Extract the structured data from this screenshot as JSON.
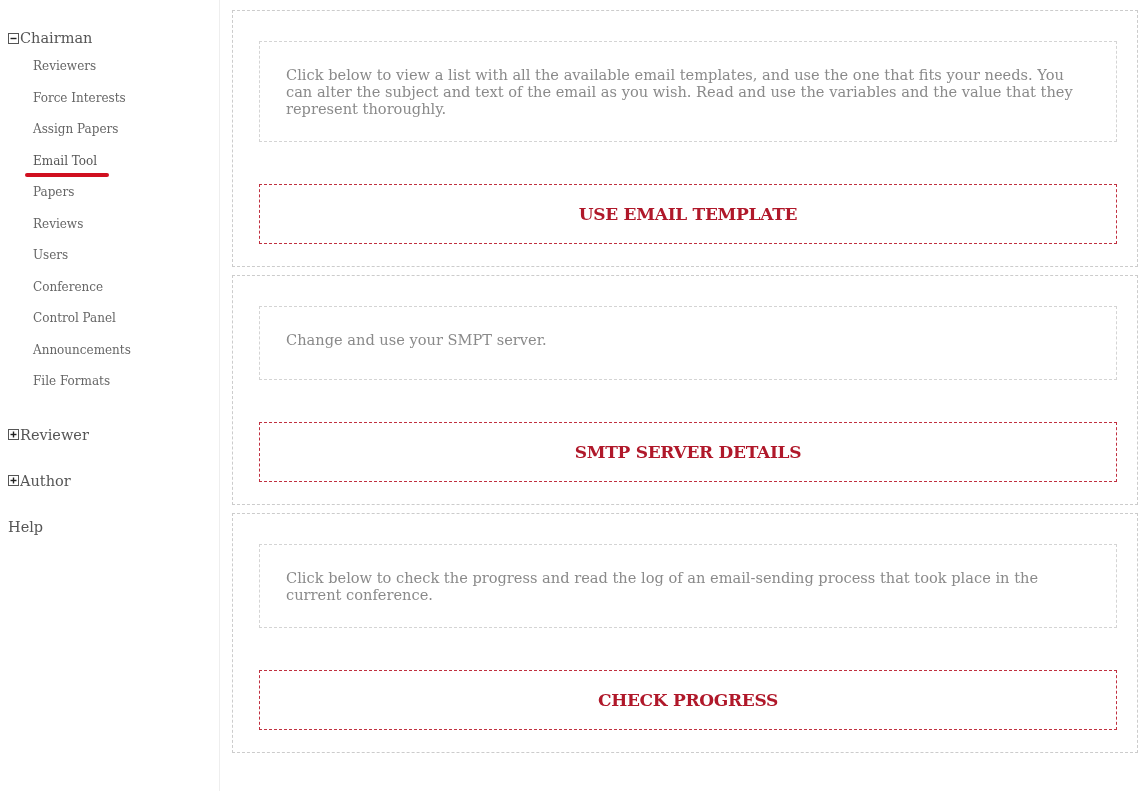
{
  "sidebar": {
    "items": [
      {
        "kind": "group",
        "label": "Chairman",
        "expanded": true,
        "children": [
          {
            "label": "Reviewers",
            "selected": false
          },
          {
            "label": "Force Interests",
            "selected": false
          },
          {
            "label": "Assign Papers",
            "selected": false
          },
          {
            "label": "Email Tool",
            "selected": true
          },
          {
            "label": "Papers",
            "selected": false
          },
          {
            "label": "Reviews",
            "selected": false
          },
          {
            "label": "Users",
            "selected": false
          },
          {
            "label": "Conference",
            "selected": false
          },
          {
            "label": "Control Panel",
            "selected": false
          },
          {
            "label": "Announcements",
            "selected": false
          },
          {
            "label": "File Formats",
            "selected": false
          }
        ]
      },
      {
        "kind": "group",
        "label": "Reviewer",
        "expanded": false
      },
      {
        "kind": "group",
        "label": "Author",
        "expanded": false
      },
      {
        "kind": "link",
        "label": "Help"
      }
    ]
  },
  "sections": [
    {
      "description": "Click below to view a list with all the available email templates, and use the one that fits your needs. You can alter the subject and text of the email as you wish. Read and use the variables and the value that they represent thoroughly.",
      "button": "USE EMAIL TEMPLATE"
    },
    {
      "description": "Change and use your SMPT server.",
      "button": "SMTP SERVER DETAILS"
    },
    {
      "description": "Click below to check the progress and read the log of an email-sending process that took place in the current conference.",
      "button": "CHECK PROGRESS"
    }
  ]
}
